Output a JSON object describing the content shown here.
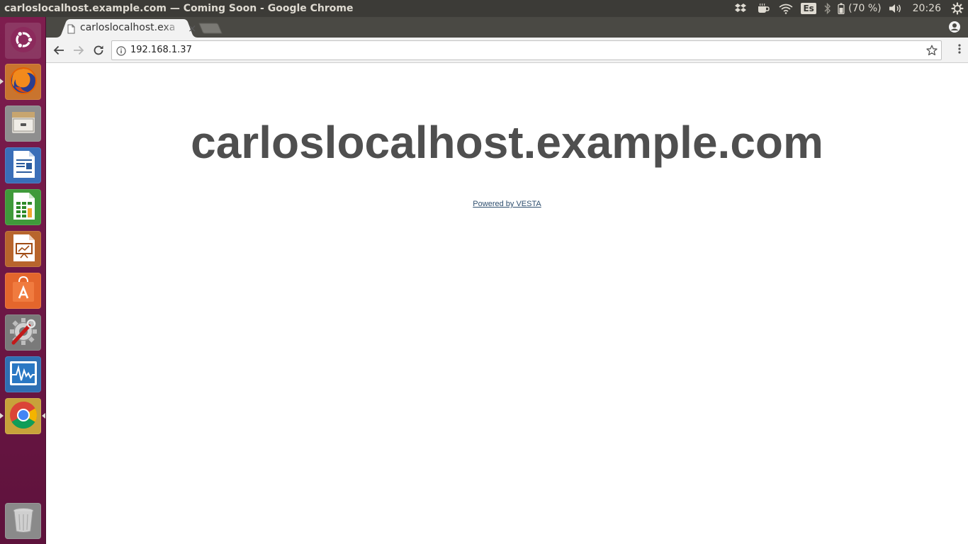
{
  "window": {
    "title": "carloslocalhost.example.com — Coming Soon - Google Chrome"
  },
  "indicators": {
    "keyboard_layout": "Es",
    "battery": "(70 %)",
    "clock": "20:26",
    "icons": [
      "dropbox-icon",
      "coffee-icon",
      "wifi-icon",
      "keyboard-layout",
      "bluetooth-icon",
      "battery-icon",
      "volume-icon",
      "settings-icon"
    ]
  },
  "launcher": {
    "items": [
      {
        "name": "ubuntu-dash",
        "icon": "ubuntu-logo-icon"
      },
      {
        "name": "firefox",
        "icon": "firefox-icon",
        "running": true
      },
      {
        "name": "files",
        "icon": "file-cabinet-icon"
      },
      {
        "name": "libreoffice-writer",
        "icon": "writer-document-icon"
      },
      {
        "name": "libreoffice-calc",
        "icon": "calc-spreadsheet-icon"
      },
      {
        "name": "libreoffice-impress",
        "icon": "impress-presentation-icon"
      },
      {
        "name": "ubuntu-software",
        "icon": "shopping-bag-icon"
      },
      {
        "name": "system-settings",
        "icon": "gear-wrench-icon"
      },
      {
        "name": "system-monitor",
        "icon": "system-monitor-icon"
      },
      {
        "name": "google-chrome",
        "icon": "chrome-icon",
        "running": true,
        "focused": true
      },
      {
        "name": "trash",
        "icon": "trash-icon"
      }
    ]
  },
  "browser": {
    "tab": {
      "title": "carloslocalhost.exa",
      "close_label": "×"
    },
    "address": {
      "url": "192.168.1.37"
    }
  },
  "page": {
    "heading": "carloslocalhost.example.com",
    "powered_by": "Powered by VESTA",
    "heading_color": "#4f4f4f",
    "link_color": "#2f4f6f"
  },
  "colors": {
    "launcher": "#7e1d4e",
    "topbar": "#3c3b37",
    "tabstrip": "#4a4944",
    "toolbar": "#f2f2f2"
  }
}
